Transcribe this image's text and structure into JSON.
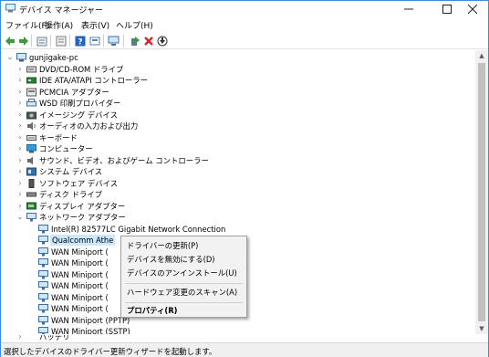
{
  "window": {
    "title": "デバイス マネージャー"
  },
  "menu": [
    "ファイル(F)",
    "操作(A)",
    "表示(V)",
    "ヘルプ(H)"
  ],
  "toolbar": {
    "icons": [
      "back-arrow-icon",
      "forward-arrow-icon",
      "properties-icon",
      "device-view-icon",
      "help-icon",
      "resource-icon",
      "monitor-icon",
      "add-driver-icon",
      "remove-device-icon",
      "download-icon"
    ],
    "colors": {
      "arrow": "#3a9b3a",
      "remove": "#d9242b",
      "help": "#2262c6"
    }
  },
  "tree": {
    "root": "gunjigake-pc",
    "categories": [
      "DVD/CD-ROM ドライブ",
      "IDE ATA/ATAPI コントローラー",
      "PCMCIA アダプター",
      "WSD 印刷プロバイダー",
      "イメージング デバイス",
      "オーディオの入力および出力",
      "キーボード",
      "コンピューター",
      "サウンド、ビデオ、およびゲーム コントローラー",
      "システム デバイス",
      "ソフトウェア デバイス",
      "ディスク ドライブ",
      "ディスプレイ アダプター",
      "ネットワーク アダプター"
    ],
    "network_children": [
      "Intel(R) 82577LC Gigabit Network Connection",
      "Qualcomm Athe",
      "WAN Miniport (",
      "WAN Miniport (",
      "WAN Miniport (",
      "WAN Miniport (",
      "WAN Miniport (",
      "WAN Miniport (",
      "WAN Miniport (PPTP)",
      "WAN Miniport (SSTP)"
    ],
    "last_partial": "バッテリ"
  },
  "context_menu": {
    "items": [
      "ドライバーの更新(P)",
      "デバイスを無効にする(D)",
      "デバイスのアンインストール(U)",
      "ハードウェア変更のスキャン(A)",
      "プロパティ(R)"
    ]
  },
  "statusbar": {
    "text": "選択したデバイスのドライバー更新ウィザードを起動します。"
  }
}
